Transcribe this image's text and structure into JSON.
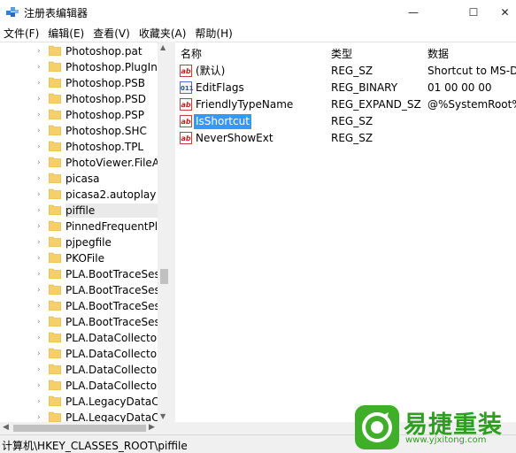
{
  "window": {
    "title": "注册表编辑器",
    "minimize_glyph": "—",
    "maximize_glyph": "☐",
    "close_glyph": "✕"
  },
  "menu": [
    "文件(F)",
    "编辑(E)",
    "查看(V)",
    "收藏夹(A)",
    "帮助(H)"
  ],
  "tree": {
    "items": [
      {
        "label": "Photoshop.pat",
        "has_children": true
      },
      {
        "label": "Photoshop.PlugIn",
        "has_children": true
      },
      {
        "label": "Photoshop.PSB",
        "has_children": true
      },
      {
        "label": "Photoshop.PSD",
        "has_children": true
      },
      {
        "label": "Photoshop.PSP",
        "has_children": true
      },
      {
        "label": "Photoshop.SHC",
        "has_children": true
      },
      {
        "label": "Photoshop.TPL",
        "has_children": true
      },
      {
        "label": "PhotoViewer.FileAss",
        "has_children": true
      },
      {
        "label": "picasa",
        "has_children": true
      },
      {
        "label": "picasa2.autoplay",
        "has_children": true
      },
      {
        "label": "piffile",
        "has_children": true,
        "selected": true
      },
      {
        "label": "PinnedFrequentPlac",
        "has_children": true
      },
      {
        "label": "pjpegfile",
        "has_children": true
      },
      {
        "label": "PKOFile",
        "has_children": true
      },
      {
        "label": "PLA.BootTraceSessi",
        "has_children": true
      },
      {
        "label": "PLA.BootTraceSessi",
        "has_children": true
      },
      {
        "label": "PLA.BootTraceSessi",
        "has_children": true
      },
      {
        "label": "PLA.BootTraceSessi",
        "has_children": true
      },
      {
        "label": "PLA.DataCollectorSe",
        "has_children": true
      },
      {
        "label": "PLA.DataCollectorSe",
        "has_children": true
      },
      {
        "label": "PLA.DataCollectorSe",
        "has_children": true
      },
      {
        "label": "PLA.DataCollectorSe",
        "has_children": true
      },
      {
        "label": "PLA.LegacyDataColl",
        "has_children": true
      },
      {
        "label": "PLA.LegacyDataColl",
        "has_children": true
      }
    ]
  },
  "values": {
    "columns": {
      "name": "名称",
      "type": "类型",
      "data": "数据"
    },
    "rows": [
      {
        "name": "(默认)",
        "type": "REG_SZ",
        "data": "Shortcut to MS-DO",
        "icon": "string-value-icon"
      },
      {
        "name": "EditFlags",
        "type": "REG_BINARY",
        "data": "01 00 00 00",
        "icon": "binary-value-icon"
      },
      {
        "name": "FriendlyTypeName",
        "type": "REG_EXPAND_SZ",
        "data": "@%SystemRoot%\\S",
        "icon": "string-value-icon"
      },
      {
        "name": "IsShortcut",
        "type": "REG_SZ",
        "data": "",
        "icon": "string-value-icon",
        "selected": true
      },
      {
        "name": "NeverShowExt",
        "type": "REG_SZ",
        "data": "",
        "icon": "string-value-icon"
      }
    ]
  },
  "statusbar": {
    "path": "计算机\\HKEY_CLASSES_ROOT\\piffile"
  },
  "watermark": {
    "title": "易捷重装",
    "url": "www.yjxitong.com"
  },
  "colors": {
    "selection": "#3399ff",
    "folder": "#f5d06a",
    "watermark_green": "#3fae29"
  }
}
